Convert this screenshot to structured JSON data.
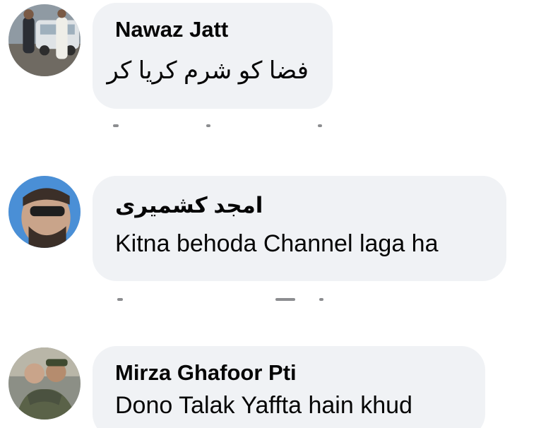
{
  "comments": [
    {
      "author": "Nawaz Jatt",
      "text": "فضا کو شرم کریا کر",
      "avatar": "profile-photo-man-with-car"
    },
    {
      "author": "امجد کشمیری",
      "text": "Kitna behoda Channel laga ha",
      "avatar": "profile-photo-man-with-sunglasses"
    },
    {
      "author": "Mirza Ghafoor Pti",
      "text": "Dono Talak Yaffta hain khud",
      "avatar": "profile-photo-soldiers-hugging"
    }
  ],
  "colors": {
    "bubble": "#f0f2f5",
    "text": "#050505",
    "meta": "#65676b"
  }
}
